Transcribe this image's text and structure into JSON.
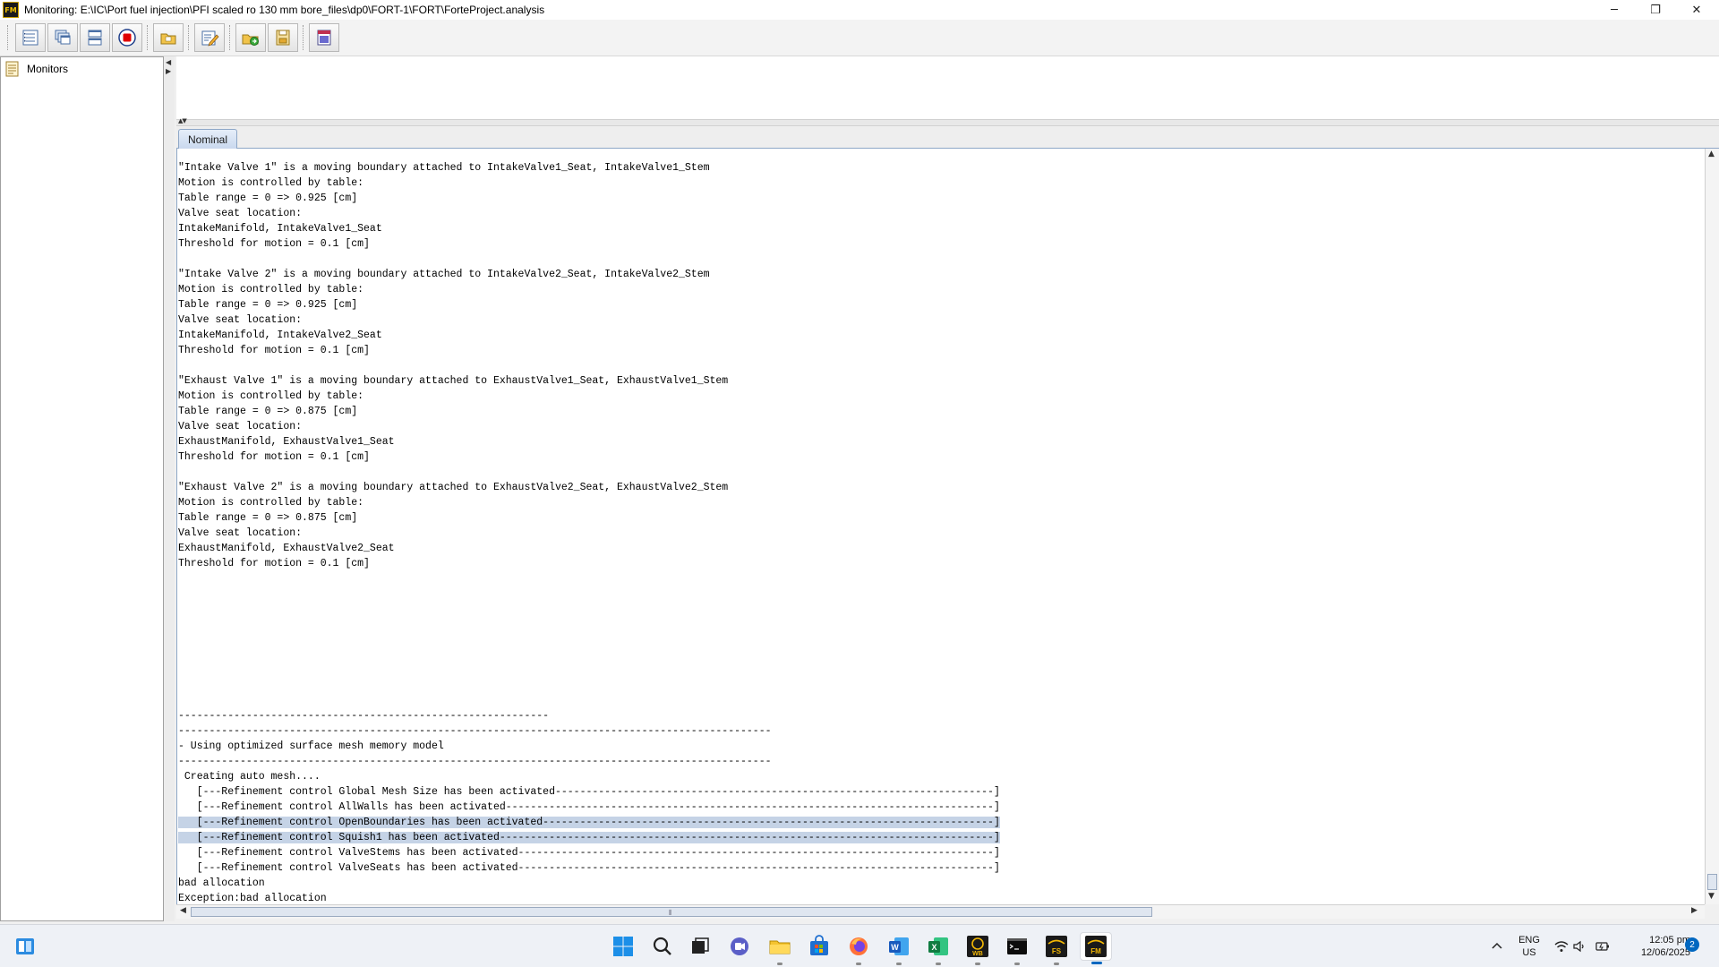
{
  "window": {
    "title": "Monitoring: E:\\IC\\Port fuel injection\\PFI scaled ro 130 mm bore_files\\dp0\\FORT-1\\FORT\\ForteProject.analysis",
    "app_icon": "FM",
    "controls": {
      "minimize": "─",
      "restore": "❐",
      "close": "✕"
    }
  },
  "toolbar": {
    "buttons": [
      {
        "icon": "list-view-icon"
      },
      {
        "icon": "cascade-windows-icon"
      },
      {
        "icon": "tile-horizontal-icon"
      },
      {
        "icon": "stop-icon"
      },
      {
        "icon": "open-folder-icon"
      },
      {
        "icon": "edit-settings-icon"
      },
      {
        "icon": "load-results-icon"
      },
      {
        "icon": "save-archive-icon"
      },
      {
        "icon": "report-icon"
      }
    ]
  },
  "tree": {
    "items": [
      {
        "label": "Monitors",
        "icon": "document-icon"
      }
    ]
  },
  "tabs": [
    {
      "label": "Nominal",
      "active": true
    }
  ],
  "console": {
    "lines": [
      "\"Intake Valve 1\" is a moving boundary attached to IntakeValve1_Seat, IntakeValve1_Stem",
      "Motion is controlled by table:",
      "Table range = 0 => 0.925 [cm]",
      "Valve seat location:",
      "IntakeManifold, IntakeValve1_Seat",
      "Threshold for motion = 0.1 [cm]",
      "",
      "\"Intake Valve 2\" is a moving boundary attached to IntakeValve2_Seat, IntakeValve2_Stem",
      "Motion is controlled by table:",
      "Table range = 0 => 0.925 [cm]",
      "Valve seat location:",
      "IntakeManifold, IntakeValve2_Seat",
      "Threshold for motion = 0.1 [cm]",
      "",
      "\"Exhaust Valve 1\" is a moving boundary attached to ExhaustValve1_Seat, ExhaustValve1_Stem",
      "Motion is controlled by table:",
      "Table range = 0 => 0.875 [cm]",
      "Valve seat location:",
      "ExhaustManifold, ExhaustValve1_Seat",
      "Threshold for motion = 0.1 [cm]",
      "",
      "\"Exhaust Valve 2\" is a moving boundary attached to ExhaustValve2_Seat, ExhaustValve2_Stem",
      "Motion is controlled by table:",
      "Table range = 0 => 0.875 [cm]",
      "Valve seat location:",
      "ExhaustManifold, ExhaustValve2_Seat",
      "Threshold for motion = 0.1 [cm]",
      "",
      "",
      "",
      "",
      "",
      "",
      "",
      "",
      "",
      "------------------------------------------------------------",
      "------------------------------------------------------------------------------------------------",
      "- Using optimized surface mesh memory model",
      "------------------------------------------------------------------------------------------------",
      " Creating auto mesh....",
      "   [---Refinement control Global Mesh Size has been activated-----------------------------------------------------------------------]",
      "   [---Refinement control AllWalls has been activated-------------------------------------------------------------------------------]",
      "   [---Refinement control OpenBoundaries has been activated-------------------------------------------------------------------------]",
      "   [---Refinement control Squish1 has been activated--------------------------------------------------------------------------------]",
      "   [---Refinement control ValveStems has been activated-----------------------------------------------------------------------------]",
      "   [---Refinement control ValveSeats has been activated-----------------------------------------------------------------------------]",
      "bad allocation",
      "Exception:bad allocation"
    ],
    "selected_lines": [
      43,
      44
    ]
  },
  "taskbar": {
    "apps": [
      {
        "icon": "windows-start-icon"
      },
      {
        "icon": "search-icon"
      },
      {
        "icon": "task-view-icon"
      },
      {
        "icon": "meet-icon"
      },
      {
        "icon": "file-explorer-icon"
      },
      {
        "icon": "store-icon"
      },
      {
        "icon": "firefox-icon"
      },
      {
        "icon": "word-icon",
        "label": "W"
      },
      {
        "icon": "excel-icon",
        "label": "X"
      },
      {
        "icon": "workbench-icon",
        "label": "WB"
      },
      {
        "icon": "terminal-icon"
      },
      {
        "icon": "forte-fs-icon",
        "label": "FS"
      },
      {
        "icon": "forte-fm-icon",
        "label": "FM"
      }
    ],
    "tray": {
      "lang_line1": "ENG",
      "lang_line2": "US",
      "time": "12:05 pm",
      "date": "12/06/2025",
      "notifications": "2"
    }
  }
}
